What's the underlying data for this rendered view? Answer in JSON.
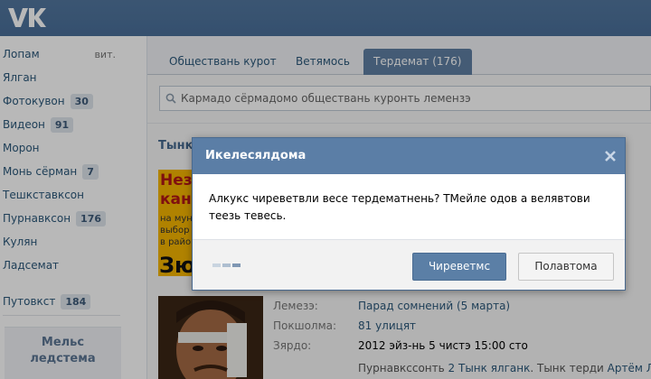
{
  "sidebar": {
    "items": [
      {
        "label": "Лопам",
        "extra": "вит."
      },
      {
        "label": "Ялган"
      },
      {
        "label": "Фотокувон",
        "count": "30"
      },
      {
        "label": "Видеон",
        "count": "91"
      },
      {
        "label": "Морон"
      },
      {
        "label": "Монь сёрман",
        "count": "7"
      },
      {
        "label": "Тешкставксон"
      },
      {
        "label": "Пурнавксон",
        "count": "176"
      },
      {
        "label": "Кулян"
      },
      {
        "label": "Ладсемат"
      }
    ],
    "extra_item": {
      "label": "Путовкст",
      "count": "184"
    },
    "box_title_line1": "Мельс",
    "box_title_line2": "ледстема"
  },
  "tabs": [
    {
      "label": "Обществань курот"
    },
    {
      "label": "Ветямось"
    },
    {
      "label": "Тердемат (176)"
    }
  ],
  "search": {
    "placeholder": "Кармадо сёрмадомо обществань куронть лемензэ"
  },
  "section_title": "Тынк",
  "banner": {
    "line1a": "Незав",
    "line1b": "канал",
    "line2a": "на мун",
    "line2b": "выбор",
    "line2c": "в район",
    "line3": "Зю"
  },
  "info": {
    "label1": "Лемезэ:",
    "value1": "Парад сомнений (5 марта)",
    "label2": "Покшолма:",
    "value2": "81 улицят",
    "label3": "Зярдо:",
    "value3": "2012 эйз-нь 5 чистэ 15:00 сто",
    "bottom_prefix": "Пурнавкссонть",
    "bottom_link1": "2 Тынк ялганк",
    "bottom_mid": ". Тынк терди",
    "bottom_link2": "Артём Лоск"
  },
  "dialog": {
    "title": "Икелесялдома",
    "body": "Алкукс чиреветвли весе тердематнень? ТМейле одов а велявтови теезь тевесь.",
    "ok_label": "Чиреветмс",
    "cancel_label": "Полавтома"
  },
  "colors": {
    "header": "#4a76a8",
    "accent": "#5b7ea6",
    "link": "#2b587a",
    "banner": "#f4b400"
  }
}
